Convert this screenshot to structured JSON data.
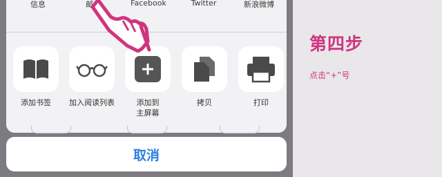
{
  "share_sheet": {
    "top_apps": [
      "信息",
      "邮件",
      "Facebook",
      "Twitter",
      "新浪微博"
    ],
    "actions": [
      {
        "label": "添加书签",
        "icon": "book-icon"
      },
      {
        "label": "加入阅读列表",
        "icon": "glasses-icon"
      },
      {
        "label": "添加到\n主屏幕",
        "icon": "plus-icon"
      },
      {
        "label": "拷贝",
        "icon": "copy-icon"
      },
      {
        "label": "打印",
        "icon": "printer-icon"
      }
    ],
    "cancel_label": "取消"
  },
  "instruction": {
    "title": "第四步",
    "desc": "点击“+”号"
  },
  "colors": {
    "accent_pink": "#d0347f",
    "ios_blue": "#2b7fe0"
  }
}
